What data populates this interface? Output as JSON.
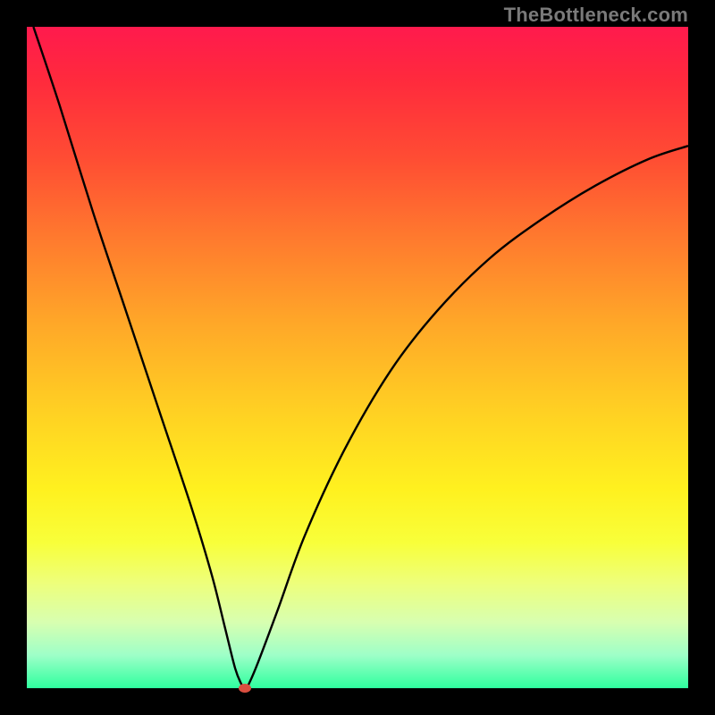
{
  "watermark": "TheBottleneck.com",
  "colors": {
    "frame": "#000000",
    "curve": "#000000",
    "marker": "#d94e3f",
    "watermark": "#7a7a7a"
  },
  "chart_data": {
    "type": "line",
    "title": "",
    "xlabel": "",
    "ylabel": "",
    "xlim": [
      0,
      100
    ],
    "ylim": [
      0,
      100
    ],
    "grid": false,
    "legend": false,
    "series": [
      {
        "name": "bottleneck-curve",
        "x": [
          1,
          5,
          10,
          15,
          20,
          25,
          28,
          30,
          31.5,
          32.5,
          33,
          33.5,
          35,
          38,
          42,
          48,
          55,
          62,
          70,
          78,
          86,
          94,
          100
        ],
        "values": [
          100,
          88,
          72,
          57,
          42,
          27,
          17,
          9,
          3,
          0.5,
          0,
          0.5,
          4,
          12,
          23,
          36,
          48,
          57,
          65,
          71,
          76,
          80,
          82
        ]
      }
    ],
    "marker": {
      "x": 33,
      "y": 0
    },
    "gradient_stops": [
      {
        "pos": 0,
        "color": "#ff1a4d"
      },
      {
        "pos": 8,
        "color": "#ff2a3d"
      },
      {
        "pos": 20,
        "color": "#ff4d33"
      },
      {
        "pos": 32,
        "color": "#ff7a2e"
      },
      {
        "pos": 45,
        "color": "#ffa828"
      },
      {
        "pos": 58,
        "color": "#ffd023"
      },
      {
        "pos": 70,
        "color": "#fff11f"
      },
      {
        "pos": 78,
        "color": "#f8ff3a"
      },
      {
        "pos": 84,
        "color": "#eeff7a"
      },
      {
        "pos": 90,
        "color": "#d8ffb0"
      },
      {
        "pos": 95,
        "color": "#9effc8"
      },
      {
        "pos": 100,
        "color": "#2eff9e"
      }
    ]
  }
}
